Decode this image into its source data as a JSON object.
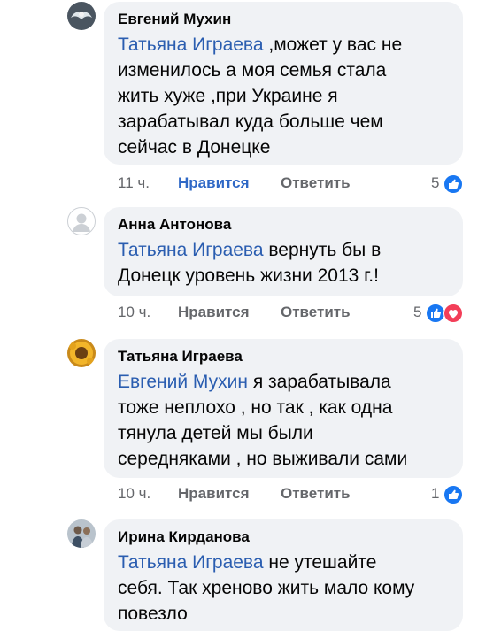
{
  "comments": [
    {
      "author": "Евгений Мухин",
      "mention": "Татьяна Играева",
      "text_line1": " ,может у вас не",
      "text_rest": [
        "изменилось а моя семья стала",
        "жить хуже ,при Украине я",
        "зарабатывал куда больше чем",
        "сейчас в Донецке"
      ],
      "time": "11 ч.",
      "like_label": "Нравится",
      "reply_label": "Ответить",
      "reaction_count": "5",
      "reactions": [
        "like-icon"
      ]
    },
    {
      "author": "Анна Антонова",
      "mention": "Татьяна Играева",
      "text_line1": " вернуть бы  в",
      "text_rest": [
        "Донецк уровень жизни 2013 г.!"
      ],
      "time": "10 ч.",
      "like_label": "Нравится",
      "reply_label": "Ответить",
      "reaction_count": "5",
      "reactions": [
        "like-icon",
        "love-icon"
      ]
    },
    {
      "author": "Татьяна Играева",
      "mention": "Евгений Мухин",
      "text_line1": " я зарабатывала",
      "text_rest": [
        "тоже неплохо , но так , как одна",
        "тянула детей мы были",
        "середняками , но выживали сами"
      ],
      "time": "10 ч.",
      "like_label": "Нравится",
      "reply_label": "Ответить",
      "reaction_count": "1",
      "reactions": [
        "like-icon"
      ]
    },
    {
      "author": "Ирина Кирданова",
      "mention": "Татьяна Играева",
      "text_line1": " не утешайте",
      "text_rest": [
        "себя. Так хреново жить мало кому",
        "повезло"
      ]
    }
  ],
  "colors": {
    "bubble": "#f0f2f5",
    "mention": "#2a5db0",
    "like_active": "#2f68c6",
    "meta": "#65676b",
    "like_reaction": "#1877f2",
    "love_reaction": "#f33e58"
  }
}
